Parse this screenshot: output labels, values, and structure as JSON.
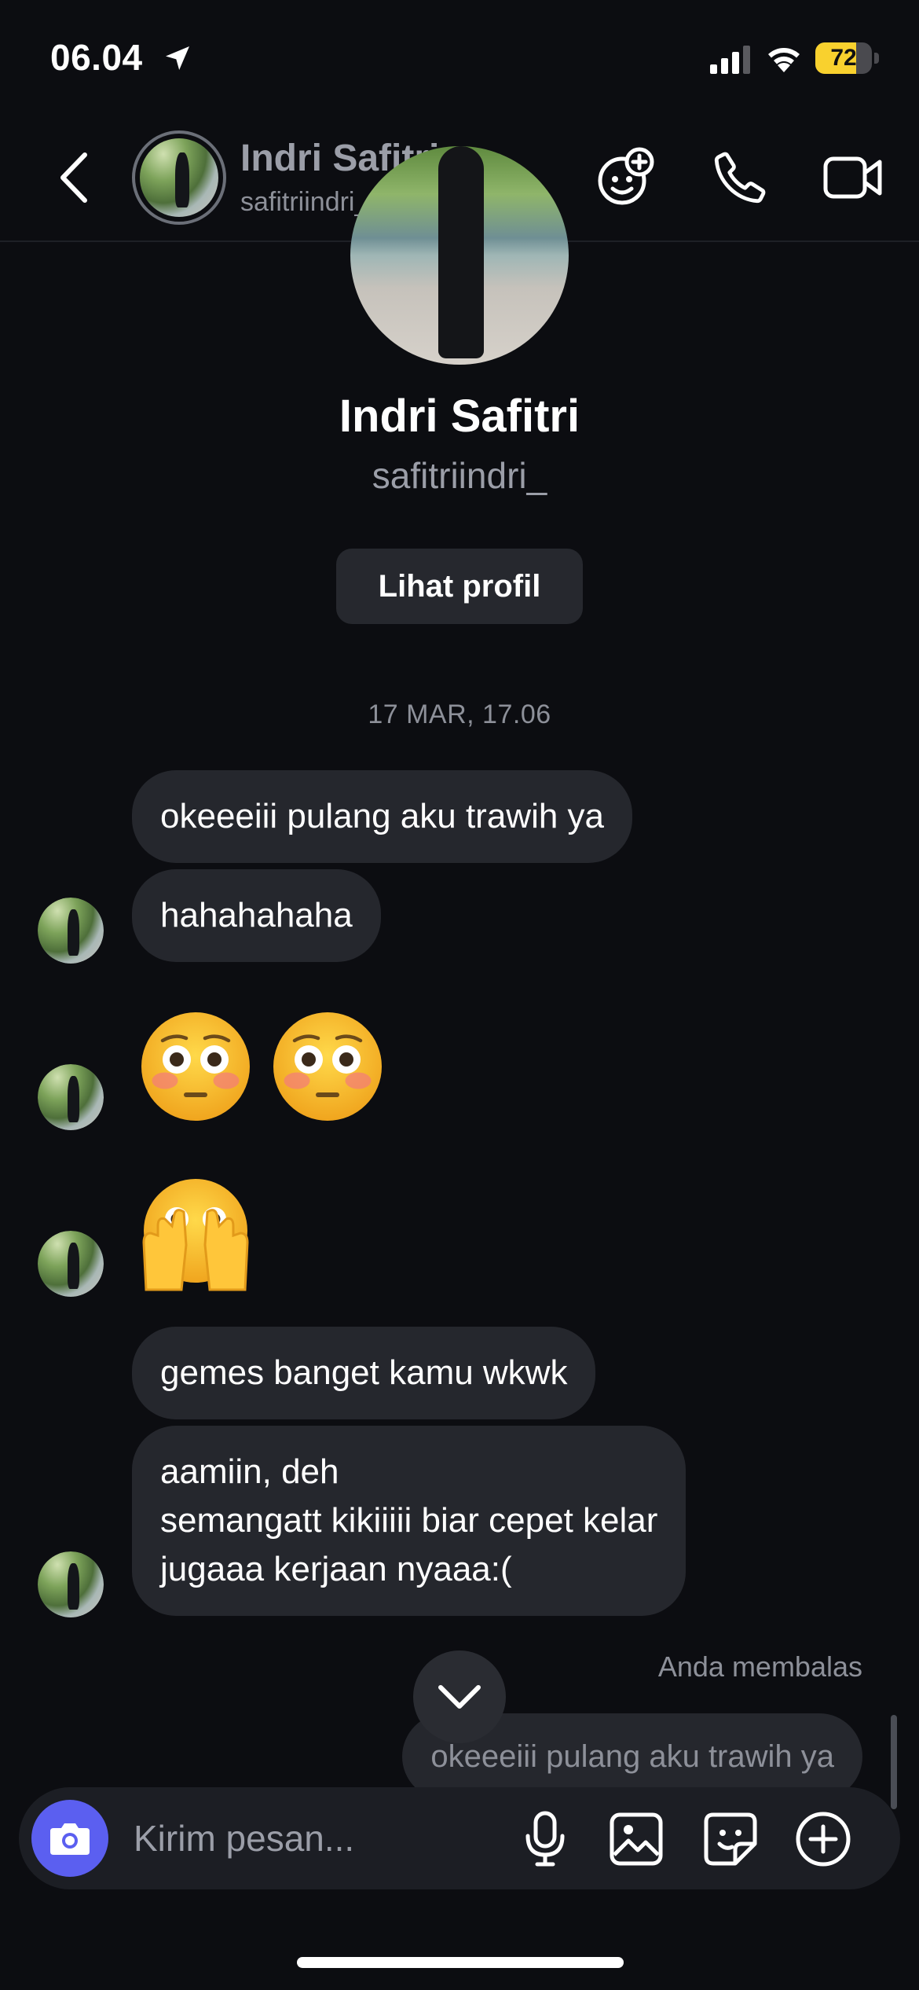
{
  "status_bar": {
    "time": "06.04",
    "battery": "72",
    "battery_level": 0.72
  },
  "header": {
    "name": "Indri Safitri",
    "username": "safitriindri_"
  },
  "profile": {
    "name": "Indri Safitri",
    "username": "safitriindri_",
    "view_profile_label": "Lihat profil"
  },
  "timestamp": "17 MAR, 17.06",
  "messages": [
    {
      "text": "okeeeiii pulang aku trawih ya"
    },
    {
      "text": "hahahahaha"
    },
    {
      "text": "gemes banget kamu wkwk"
    },
    {
      "text": "aamiin, deh\nsemangatt kikiiiii biar cepet kelar\njugaaa kerjaan nyaaa:("
    }
  ],
  "reply": {
    "label": "Anda membalas",
    "text": "okeeeiii pulang aku trawih ya"
  },
  "composer": {
    "placeholder": "Kirim pesan..."
  },
  "colors": {
    "accent": "#5b5ff0",
    "bubble": "#25272d",
    "background": "#0c0d11",
    "battery": "#f9d12e"
  }
}
